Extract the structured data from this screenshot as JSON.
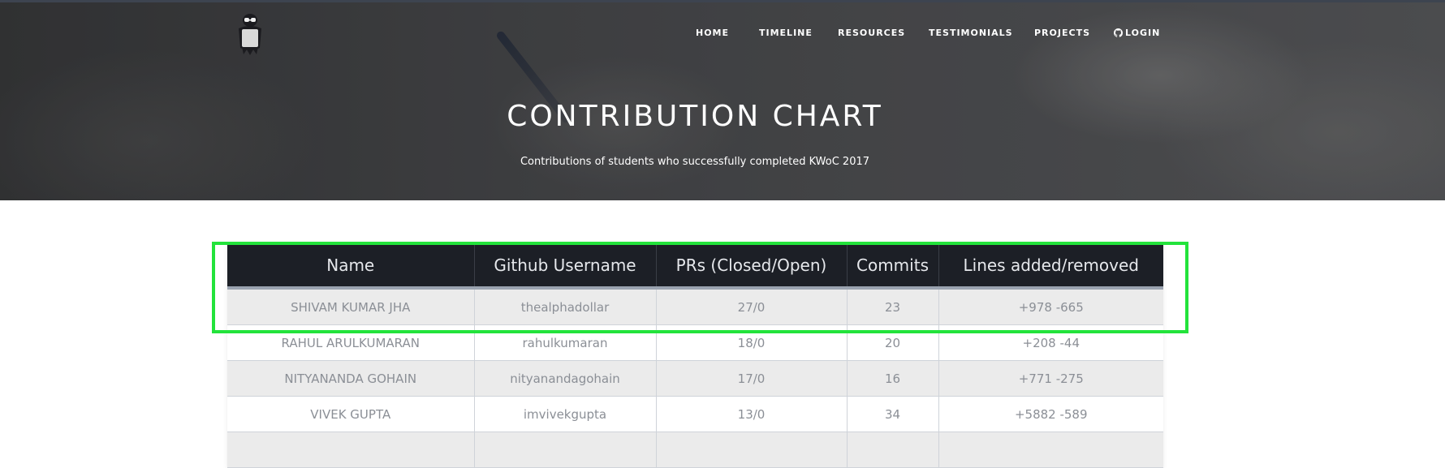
{
  "nav": {
    "home": "HOME",
    "timeline": "TIMELINE",
    "resources": "RESOURCES",
    "testimonials": "TESTIMONIALS",
    "projects": "PROJECTS",
    "login": "LOGIN"
  },
  "hero": {
    "title": "CONTRIBUTION CHART",
    "subtitle": "Contributions of students who successfully completed KWoC 2017"
  },
  "table": {
    "headers": [
      "Name",
      "Github Username",
      "PRs (Closed/Open)",
      "Commits",
      "Lines added/removed"
    ],
    "rows": [
      [
        "SHIVAM KUMAR JHA",
        "thealphadollar",
        "27/0",
        "23",
        "+978 -665"
      ],
      [
        "RAHUL ARULKUMARAN",
        "rahulkumaran",
        "18/0",
        "20",
        "+208 -44"
      ],
      [
        "NITYANANDA GOHAIN",
        "nityanandagohain",
        "17/0",
        "16",
        "+771 -275"
      ],
      [
        "VIVEK GUPTA",
        "imvivekgupta",
        "13/0",
        "34",
        "+5882 -589"
      ]
    ]
  },
  "colors": {
    "header_bg": "#1c1f26",
    "highlight": "#23e33b",
    "row_odd": "#ebebeb",
    "row_even": "#ffffff"
  }
}
